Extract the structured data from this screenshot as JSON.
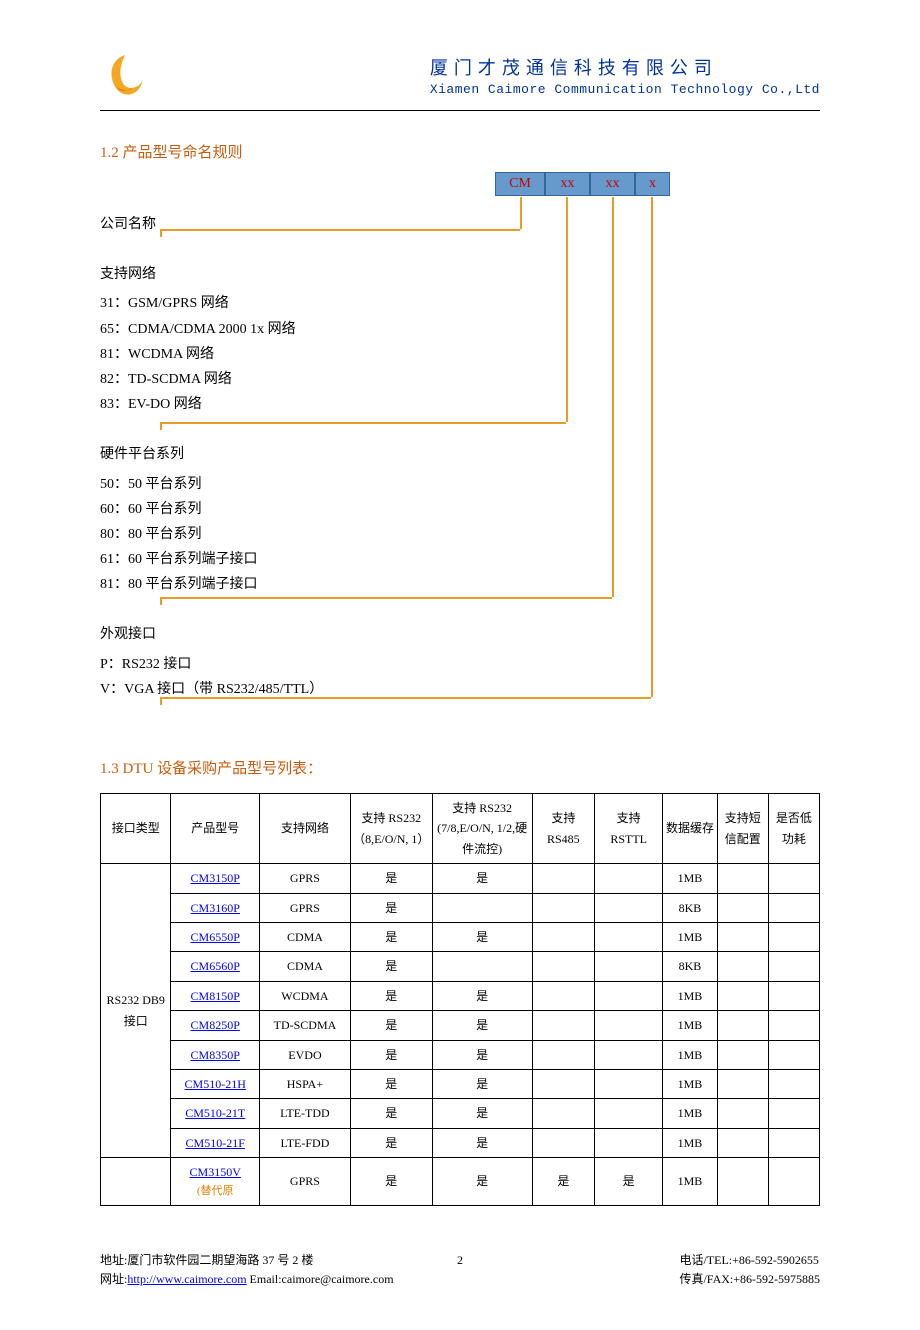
{
  "header": {
    "company_cn": "厦门才茂通信科技有限公司",
    "company_en": "Xiamen Caimore Communication Technology Co.,Ltd"
  },
  "section12": {
    "title": "1.2 产品型号命名规则",
    "code_boxes": [
      "CM",
      "xx",
      "xx",
      "x"
    ],
    "blocks": [
      {
        "label": "公司名称",
        "items": []
      },
      {
        "label": "支持网络",
        "items": [
          "31：GSM/GPRS 网络",
          "65：CDMA/CDMA 2000 1x 网络",
          "81：WCDMA 网络",
          "82：TD-SCDMA 网络",
          "83：EV-DO 网络"
        ]
      },
      {
        "label": "硬件平台系列",
        "items": [
          "50：50 平台系列",
          "60：60 平台系列",
          "80：80 平台系列",
          "61：60 平台系列端子接口",
          "81：80 平台系列端子接口"
        ]
      },
      {
        "label": "外观接口",
        "items": [
          "P：RS232 接口",
          "V：VGA 接口（带 RS232/485/TTL）"
        ]
      }
    ]
  },
  "section13": {
    "title": "1.3 DTU 设备采购产品型号列表：",
    "headers": [
      "接口类型",
      "产品型号",
      "支持网络",
      "支持 RS232（8,E/O/N, 1）",
      "支持 RS232 (7/8,E/O/N, 1/2,硬件流控)",
      "支持 RS485",
      "支持 RSTTL",
      "数据缓存",
      "支持短信配置",
      "是否低功耗"
    ],
    "group_label": "RS232 DB9 接口",
    "rows": [
      {
        "model": "CM3150P",
        "net": "GPRS",
        "c1": "是",
        "c2": "是",
        "c3": "",
        "c4": "",
        "cache": "1MB",
        "sms": "",
        "low": ""
      },
      {
        "model": "CM3160P",
        "net": "GPRS",
        "c1": "是",
        "c2": "",
        "c3": "",
        "c4": "",
        "cache": "8KB",
        "sms": "",
        "low": ""
      },
      {
        "model": "CM6550P",
        "net": "CDMA",
        "c1": "是",
        "c2": "是",
        "c3": "",
        "c4": "",
        "cache": "1MB",
        "sms": "",
        "low": ""
      },
      {
        "model": "CM6560P",
        "net": "CDMA",
        "c1": "是",
        "c2": "",
        "c3": "",
        "c4": "",
        "cache": "8KB",
        "sms": "",
        "low": ""
      },
      {
        "model": "CM8150P",
        "net": "WCDMA",
        "c1": "是",
        "c2": "是",
        "c3": "",
        "c4": "",
        "cache": "1MB",
        "sms": "",
        "low": ""
      },
      {
        "model": "CM8250P",
        "net": "TD-SCDMA",
        "c1": "是",
        "c2": "是",
        "c3": "",
        "c4": "",
        "cache": "1MB",
        "sms": "",
        "low": ""
      },
      {
        "model": "CM8350P",
        "net": "EVDO",
        "c1": "是",
        "c2": "是",
        "c3": "",
        "c4": "",
        "cache": "1MB",
        "sms": "",
        "low": ""
      },
      {
        "model": "CM510-21H",
        "net": "HSPA+",
        "c1": "是",
        "c2": "是",
        "c3": "",
        "c4": "",
        "cache": "1MB",
        "sms": "",
        "low": ""
      },
      {
        "model": "CM510-21T",
        "net": "LTE-TDD",
        "c1": "是",
        "c2": "是",
        "c3": "",
        "c4": "",
        "cache": "1MB",
        "sms": "",
        "low": ""
      },
      {
        "model": "CM510-21F",
        "net": "LTE-FDD",
        "c1": "是",
        "c2": "是",
        "c3": "",
        "c4": "",
        "cache": "1MB",
        "sms": "",
        "low": ""
      }
    ],
    "extra_row": {
      "model": "CM3150V",
      "note": "(替代原",
      "net": "GPRS",
      "c1": "是",
      "c2": "是",
      "c3": "是",
      "c4": "是",
      "cache": "1MB",
      "sms": "",
      "low": ""
    }
  },
  "footer": {
    "address": "地址:厦门市软件园二期望海路 37 号 2 楼",
    "website_label": "网址:",
    "website": "http://www.caimore.com",
    "email": " Email:caimore@caimore.com",
    "page": "2",
    "tel": "电话/TEL:+86-592-5902655",
    "fax": "传真/FAX:+86-592-5975885"
  }
}
